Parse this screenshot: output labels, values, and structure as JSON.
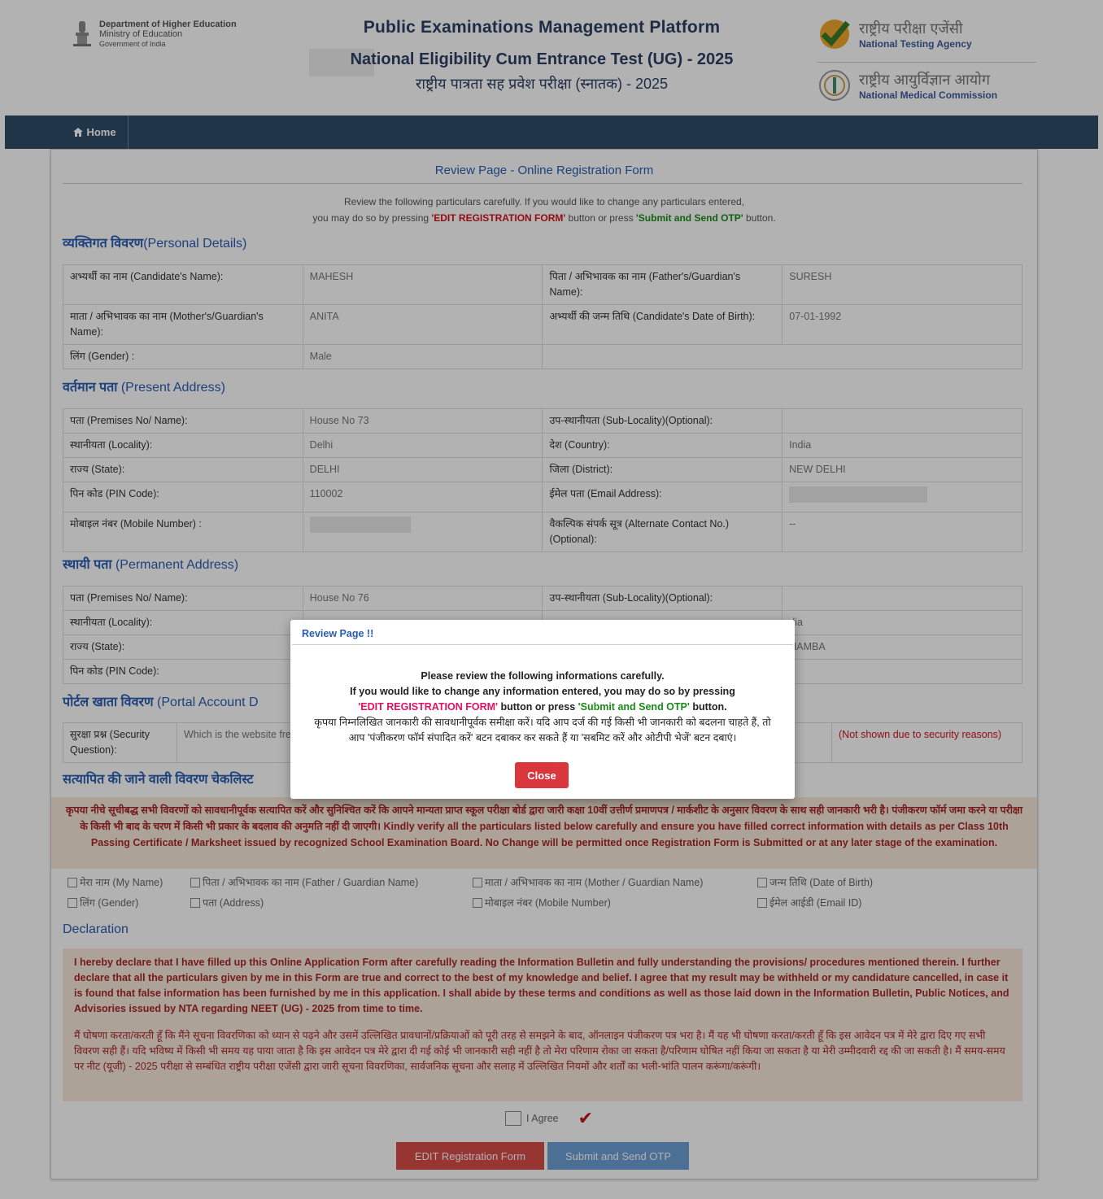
{
  "header": {
    "dept": "Department of Higher Education",
    "ministry": "Ministry of Education",
    "govt": "Government of India",
    "platform_title": "Public Examinations Management Platform",
    "exam_title": "National Eligibility Cum Entrance Test (UG) - 2025",
    "exam_title_hi": "राष्ट्रीय पात्रता सह प्रवेश परीक्षा (स्नातक) - 2025",
    "nta_hi": "राष्ट्रीय परीक्षा एजेंसी",
    "nta_en": "National Testing Agency",
    "nmc_hi": "राष्ट्रीय आयुर्विज्ञान आयोग",
    "nmc_en": "National Medical Commission"
  },
  "nav": {
    "home": "Home"
  },
  "page": {
    "title": "Review Page - Online Registration Form",
    "intro_line1": "Review the following particulars carefully. If you would like to change any particulars entered,",
    "intro_prefix": "you may do so by pressing ",
    "intro_edit": "'EDIT REGISTRATION FORM'",
    "intro_mid": " button or press ",
    "intro_submit": "'Submit and Send OTP'",
    "intro_suffix": " button."
  },
  "sections": {
    "personal_hi": "व्यक्तिगत विवरण",
    "personal_en": "(Personal Details)",
    "present_hi": "वर्तमान पता",
    "present_en": " (Present Address)",
    "permanent_hi": "स्थायी पता",
    "permanent_en": " (Permanent Address)",
    "portal_hi": "पोर्टल खाता विवरण",
    "portal_en": " (Portal Account D",
    "checklist_hi": "सत्यापित की जाने वाली विवरण चेकलिस्ट",
    "declaration": "Declaration"
  },
  "personal": {
    "name_label": "अभ्यर्थी का नाम (Candidate's Name):",
    "name": "MAHESH",
    "father_label": "पिता / अभिभावक का नाम (Father's/Guardian's Name):",
    "father": "SURESH",
    "mother_label": "माता / अभिभावक का नाम (Mother's/Guardian's Name):",
    "mother": "ANITA",
    "dob_label": "अभ्यर्थी की जन्म तिथि (Candidate's Date of Birth):",
    "dob": "07-01-1992",
    "gender_label": "लिंग (Gender) :",
    "gender": "Male"
  },
  "present": {
    "premises_label": "पता (Premises No/ Name):",
    "premises": "House No 73",
    "sublocality_label": "उप-स्थानीयता (Sub-Locality)(Optional):",
    "sublocality": "",
    "locality_label": "स्थानीयता (Locality):",
    "locality": "Delhi",
    "country_label": "देश (Country):",
    "country": "India",
    "state_label": "राज्य (State):",
    "state": "DELHI",
    "district_label": "जिला (District):",
    "district": "NEW DELHI",
    "pin_label": "पिन कोड (PIN Code):",
    "pin": "110002",
    "email_label": "ईमेल पता (Email Address):",
    "mobile_label": "मोबाइल नंबर (Mobile Number) :",
    "alt_label": "वैकल्पिक संपर्क सूत्र (Alternate Contact No.) (Optional):",
    "alt": "--"
  },
  "permanent": {
    "premises_label": "पता (Premises No/ Name):",
    "premises": "House No 76",
    "sublocality_label": "उप-स्थानीयता (Sub-Locality)(Optional):",
    "locality_label": "स्थानीयता (Locality):",
    "country_tail": "dia",
    "state_label": "राज्य (State):",
    "district_tail": "HAMBA",
    "pin_label": "पिन कोड (PIN Code):"
  },
  "portal": {
    "sq_label": "सुरक्षा प्रश्न (Security Question):",
    "sq_value": "Which is the website frequently visit ?",
    "answer_note": "(Not shown due to security reasons)"
  },
  "warning": "कृपया नीचे सूचीबद्ध सभी विवरणों को सावधानीपूर्वक सत्यापित करें और सुनिश्चित करें कि आपने मान्यता प्राप्त स्कूल परीक्षा बोर्ड द्वारा जारी कक्षा 10वीं उत्तीर्ण प्रमाणपत्र / मार्कशीट के अनुसार विवरण के साथ सही जानकारी भरी है। पंजीकरण फॉर्म जमा करने या परीक्षा के किसी भी बाद के चरण में किसी भी प्रकार के बदलाव की अनुमति नहीं दी जाएगी। Kindly verify all the particulars listed below carefully and ensure you have filled correct information with details as per Class 10th Passing Certificate / Marksheet issued by recognized School Examination Board. No Change will be permitted once Registration Form is Submitted or at any later stage of the examination.",
  "checklist": {
    "my_name": "मेरा नाम (My Name)",
    "father": "पिता / अभिभावक का नाम (Father / Guardian Name)",
    "mother": "माता / अभिभावक का नाम (Mother / Guardian Name)",
    "dob": "जन्म तिथि (Date of Birth)",
    "gender": "लिंग (Gender)",
    "address": "पता (Address)",
    "mobile": "मोबाइल नंबर (Mobile Number)",
    "email": "ईमेल आईडी (Email ID)"
  },
  "declaration": {
    "en": "I hereby declare that I have filled up this Online Application Form after carefully reading the Information Bulletin and fully understanding the provisions/ procedures mentioned therein. I further declare that all the particulars given by me in this Form are true and correct to the best of my knowledge and belief. I agree that my result may be withheld or my candidature cancelled, in case it is found that false information has been furnished by me in this application. I shall abide by these terms and conditions as well as those laid down in the Information Bulletin, Public Notices, and Advisories issued by NTA regarding NEET (UG) - 2025 from time to time.",
    "hi": "मैं घोषणा करता/करती हूँ कि मैंने सूचना विवरणिका को ध्यान से पढ़ने और उसमें उल्लिखित प्रावधानों/प्रक्रियाओं को पूरी तरह से समझने के बाद, ऑनलाइन पंजीकरण पत्र भरा है। मैं यह भी घोषणा करता/करती हूँ कि इस आवेदन पत्र में मेरे द्वारा दिए गए सभी विवरण सही हैं। यदि भविष्य में किसी भी समय यह पाया जाता है कि इस आवेदन पत्र मेरे द्वारा दी गई कोई भी जानकारी सही नहीं है तो मेरा परिणाम रोका जा सकता है/परिणाम घोषित नहीं किया जा सकता है या मेरी उम्मीदवारी रद्द की जा सकती है। मैं समय-समय पर नीट (यूजी) - 2025 परीक्षा से सम्बंधित राष्ट्रीय परीक्षा एजेंसी द्वारा जारी सूचना विवरणिका, सार्वजनिक सूचना और सलाह में उल्लिखित नियमों और शर्तों का भली-भांति पालन करूंगा/करूंगी।",
    "agree": "I Agree"
  },
  "buttons": {
    "edit": "EDIT Registration Form",
    "submit": "Submit and Send OTP"
  },
  "modal": {
    "title": "Review Page !!",
    "line1": "Please review the following informations carefully.",
    "line2": "If you would like to change any information entered, you may do so by pressing",
    "edit": "'EDIT REGISTRATION FORM'",
    "mid": " button or press ",
    "submit": "'Submit and Send OTP'",
    "end": " button.",
    "hi": "कृपया निम्नलिखित जानकारी की सावधानीपूर्वक समीक्षा करें। यदि आप दर्ज की गई किसी भी जानकारी को बदलना चाहते हैं, तो आप 'पंजीकरण फॉर्म संपादित करें' बटन दबाकर कर सकते हैं या 'सबमिट करें और ओटीपी भेजें' बटन दबाएं।",
    "close": "Close"
  },
  "colors": {
    "navbar": "#2f4c66",
    "accent_blue": "#2a5db0",
    "alert_red": "#d0141b",
    "green": "#1a8a1a",
    "warning_bg": "#f7e8d9"
  }
}
